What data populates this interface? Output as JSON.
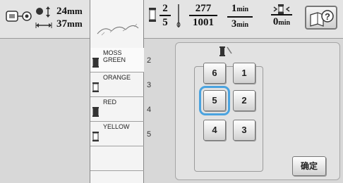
{
  "header": {
    "height_value": "24",
    "height_unit": "mm",
    "width_value": "37",
    "width_unit": "mm",
    "color_current": "2",
    "color_total": "5",
    "stitch_current": "277",
    "stitch_total": "1001",
    "time_current": "1",
    "time_current_unit": "min",
    "time_total": "3",
    "time_total_unit": "min",
    "remaining_time": "0",
    "remaining_time_unit": "min"
  },
  "threads": [
    {
      "name": "MOSS\nGREEN",
      "number": "2",
      "color": "#333333"
    },
    {
      "name": "ORANGE",
      "number": "3",
      "color": "#ffffff"
    },
    {
      "name": "RED",
      "number": "4",
      "color": "#333333"
    },
    {
      "name": "YELLOW",
      "number": "5",
      "color": "#ffffff"
    }
  ],
  "needle_buttons": [
    {
      "label": "6"
    },
    {
      "label": "1"
    },
    {
      "label": "5"
    },
    {
      "label": "2"
    },
    {
      "label": "4"
    },
    {
      "label": "3"
    }
  ],
  "selected_needle": "5",
  "ok_label": "确定",
  "colors": {
    "selection": "#4aa3df"
  }
}
